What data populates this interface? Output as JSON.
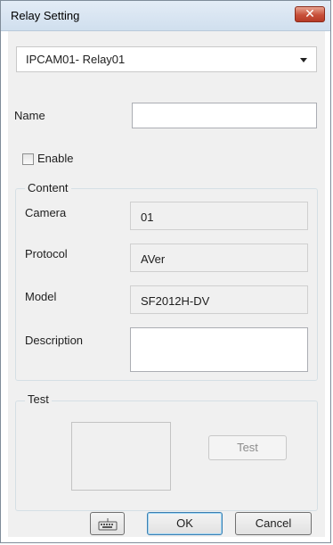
{
  "window": {
    "title": "Relay Setting"
  },
  "relay_select": {
    "value": "IPCAM01- Relay01"
  },
  "name_field": {
    "label": "Name",
    "value": ""
  },
  "enable": {
    "label": "Enable",
    "checked": false
  },
  "content": {
    "group_title": "Content",
    "camera": {
      "label": "Camera",
      "value": "01"
    },
    "protocol": {
      "label": "Protocol",
      "value": "AVer"
    },
    "model": {
      "label": "Model",
      "value": "SF2012H-DV"
    },
    "description": {
      "label": "Description",
      "value": ""
    }
  },
  "test": {
    "group_title": "Test",
    "button_label": "Test"
  },
  "footer": {
    "keyboard_icon": "keyboard-icon",
    "ok_label": "OK",
    "cancel_label": "Cancel"
  },
  "colors": {
    "close_button": "#c8503a",
    "dialog_background": "#f0f0f0"
  }
}
